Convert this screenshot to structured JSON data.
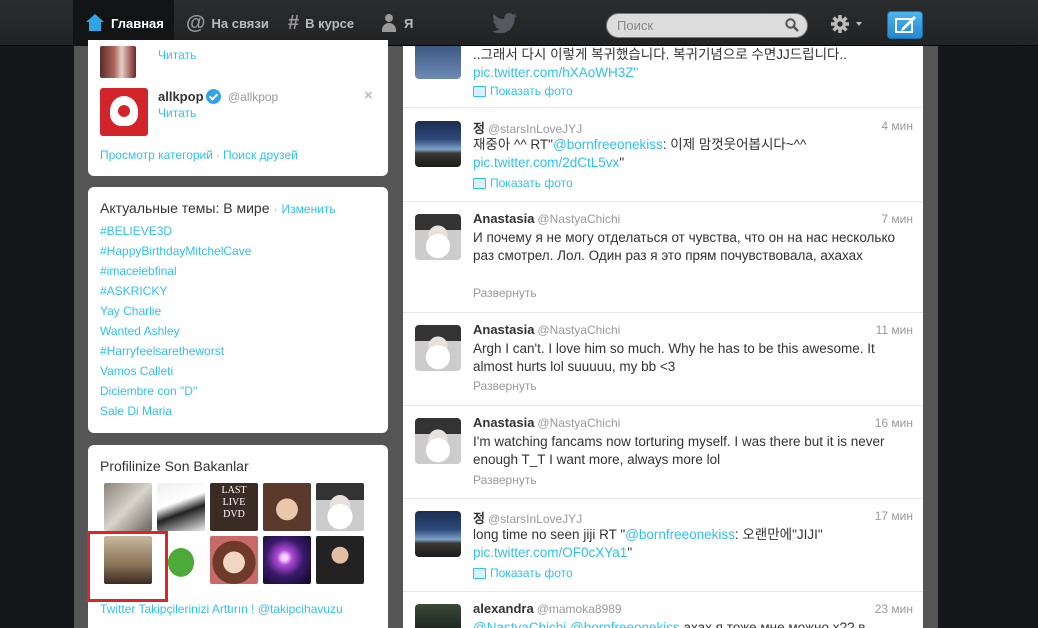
{
  "topbar": {
    "home": "Главная",
    "connect": "На связи",
    "discover": "В курсе",
    "me": "Я",
    "search_placeholder": "Поиск"
  },
  "who_to_follow": {
    "partial_follow": "Читать",
    "account": {
      "name": "allkpop",
      "handle": "@allkpop",
      "follow": "Читать",
      "close": "×"
    },
    "footer_browse": "Просмотр категорий",
    "footer_sep": "·",
    "footer_find": "Поиск друзей"
  },
  "trends": {
    "title": "Актуальные темы: В мире",
    "dot": "·",
    "change": "Изменить",
    "items": [
      "#BELIEVE3D",
      "#HappyBirthdayMitchelCave",
      "#imacelebfinal",
      "#ASKRICKY",
      "Yay Charlie",
      "Wanted Ashley",
      "#Harryfeelsaretheworst",
      "Vamos Calleti",
      "Diciembre con \"D\"",
      "Sale Di Maria"
    ]
  },
  "viewers": {
    "title": "Profilinize Son Bakanlar",
    "thumb_text_line1": "LAST LIVE",
    "thumb_text_line2": "DVD",
    "thumb_text_line3": "INE RELE",
    "footer": "Twitter Takipçilerinizi Arttırın ! @takipcihavuzu"
  },
  "tweets": [
    {
      "text": "..그래서 다시 이렇게 복귀했습니다. 복귀기념으로 수면JJ드립니다..",
      "link": "pic.twitter.com/hXAoWH3Z\"",
      "action": "Показать фото"
    },
    {
      "name": "정",
      "handle": "@starsInLoveJYJ",
      "time": "4 мин",
      "text_a": "재중아 ^^ RT\"",
      "mention": "@bornfreeonekiss",
      "text_b": ": 이제 맘껏웃어봅시다~^^",
      "link": "pic.twitter.com/2dCtL5vx",
      "link_tail": "\"",
      "action": "Показать фото"
    },
    {
      "name": "Anastasia",
      "handle": "@NastyaChichi",
      "time": "7 мин",
      "text": "И почему я не могу отделаться от чувства, что он на нас несколько раз смотрел. Лол. Один раз я это прям почувствовала, ахахах",
      "action": "Развернуть"
    },
    {
      "name": "Anastasia",
      "handle": "@NastyaChichi",
      "time": "11 мин",
      "text": "Argh I can't. I love him so much. Why he has to be this awesome. It almost hurts lol suuuuu, my bb <3",
      "action": "Развернуть"
    },
    {
      "name": "Anastasia",
      "handle": "@NastyaChichi",
      "time": "16 мин",
      "text": "I'm watching fancams now torturing myself. I was there but it is never enough T_T I want more, always more lol",
      "action": "Развернуть"
    },
    {
      "name": "정",
      "handle": "@starsInLoveJYJ",
      "time": "17 мин",
      "text_a": "long time no seen jiji RT \"",
      "mention": "@bornfreeonekiss",
      "text_b": ": 오랜만에\"JIJI\"",
      "link": "pic.twitter.com/OF0cXYa1",
      "link_tail": "\"",
      "action": "Показать фото"
    },
    {
      "name": "alexandra",
      "handle": "@mamoka8989",
      "time": "23 мин",
      "mention_a": "@NastyaChichi",
      "mention_b": "@bornfreeonekiss",
      "text": "ахах я тоже мне можно x?? в"
    }
  ]
}
